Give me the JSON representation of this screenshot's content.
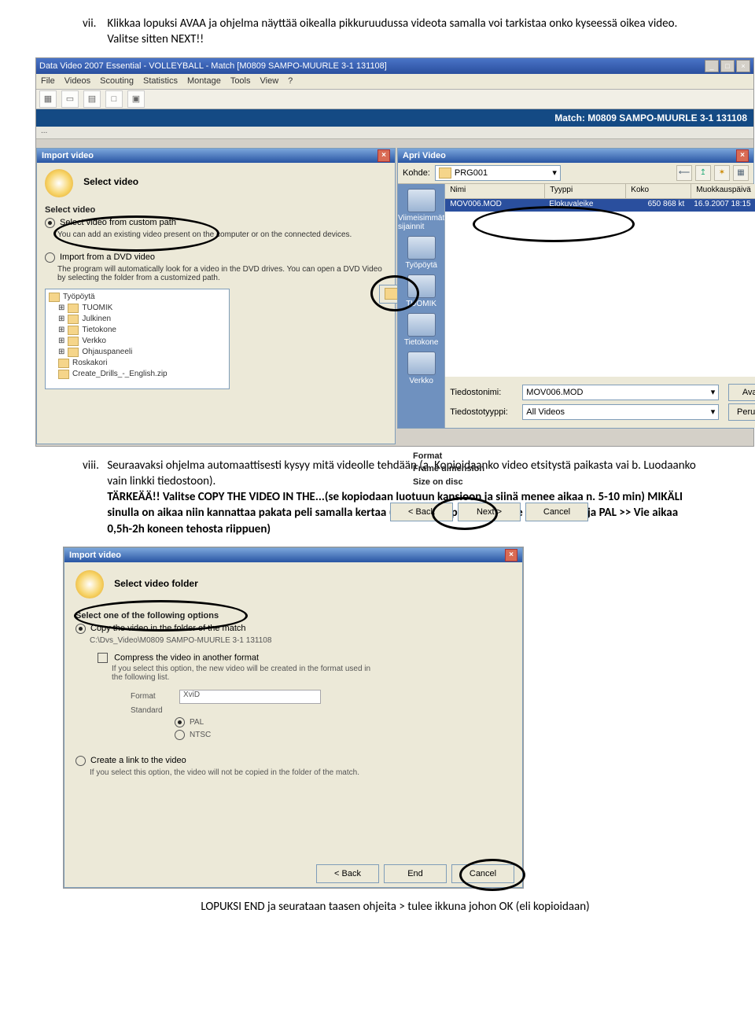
{
  "instr7": {
    "num": "vii.",
    "text": "Klikkaa lopuksi AVAA ja ohjelma näyttää oikealla pikkuruudussa videota samalla voi tarkistaa onko kyseessä oikea video. Valitse sitten NEXT!!"
  },
  "instr8": {
    "num": "viii.",
    "text_a": "Seuraavaksi ohjelma automaattisesti kysyy mitä videolle tehdään (a. Kopioidaanko video etsitystä paikasta vai b. Luodaanko vain linkki tiedostoon).",
    "text_b": "TÄRKEÄÄ!! Valitse COPY THE VIDEO IN THE...(se kopiodaan luotuun kansioon ja siinä menee aikaa n. 5-10 min) MIKÄLI sinulla on aikaa niin kannattaa pakata peli samalla kertaa (ruksita Compress ja valitse Format:Xvid ja PAL >> Vie aikaa 0,5h-2h koneen tehosta riippuen)"
  },
  "footer": "LOPUKSI END ja seurataan taasen ohjeita > tulee ikkuna johon OK (eli kopioidaan)",
  "app": {
    "title": "Data Video 2007 Essential - VOLLEYBALL - Match [M0809 SAMPO-MUURLE 3-1 131108]",
    "menus": [
      "File",
      "Videos",
      "Scouting",
      "Statistics",
      "Montage",
      "Tools",
      "View",
      "?"
    ],
    "match_label": "Match:",
    "match_name": "M0809 SAMPO-MUURLE 3-1 131108",
    "breadcrumb": "..."
  },
  "import": {
    "title": "Import video",
    "heading": "Select video",
    "sub": "Select video",
    "opt1": "Select video from custom path",
    "hint1": "You can add an existing video present on the computer or on the connected devices.",
    "opt2": "Import from a DVD video",
    "hint2": "The program will automatically look for a video in the DVD drives. You can open a DVD Video by selecting the folder from a customized path.",
    "tree": [
      "Työpöytä",
      "TUOMIK",
      "Julkinen",
      "Tietokone",
      "Verkko",
      "Ohjauspaneeli",
      "Roskakori",
      "Create_Drills_-_English.zip"
    ],
    "nav": {
      "back": "< Back",
      "next": "Next >",
      "cancel": "Cancel"
    },
    "extra": [
      "Format",
      "Frame dimension",
      "Size on disc"
    ]
  },
  "apri": {
    "title": "Apri Video",
    "kohde_label": "Kohde:",
    "folder": "PRG001",
    "cols": [
      "Nimi",
      "Tyyppi",
      "Koko",
      "Muokkauspäivä"
    ],
    "file": {
      "name": "MOV006.MOD",
      "type": "Elokuvaleike",
      "size": "650 868 kt",
      "date": "16.9.2007 18:15"
    },
    "side": [
      "Viimeisimmät sijainnit",
      "Työpöytä",
      "TUOMIK",
      "Tietokone",
      "Verkko"
    ],
    "fn_label": "Tiedostonimi:",
    "ft_label": "Tiedostotyyppi:",
    "fn": "MOV006.MOD",
    "ft": "All Videos",
    "open": "Avaa",
    "cancel": "Peruuta"
  },
  "import2": {
    "title": "Import video",
    "heading": "Select video folder",
    "sub": "Select one of the following options",
    "opt1": "Copy the video in the folder of the match",
    "path": "C:\\Dvs_Video\\M0809 SAMPO-MUURLE 3-1 131108",
    "chk": "Compress the video in another format",
    "chk_hint": "If you select this option, the new video will be created in the format used in the following list.",
    "format_label": "Format",
    "format_val": "XviD",
    "std_label": "Standard",
    "pal": "PAL",
    "ntsc": "NTSC",
    "opt2": "Create a link to the video",
    "hint2": "If you select this option, the video will not be copied in the folder of the match.",
    "nav": {
      "back": "< Back",
      "end": "End",
      "cancel": "Cancel"
    }
  }
}
